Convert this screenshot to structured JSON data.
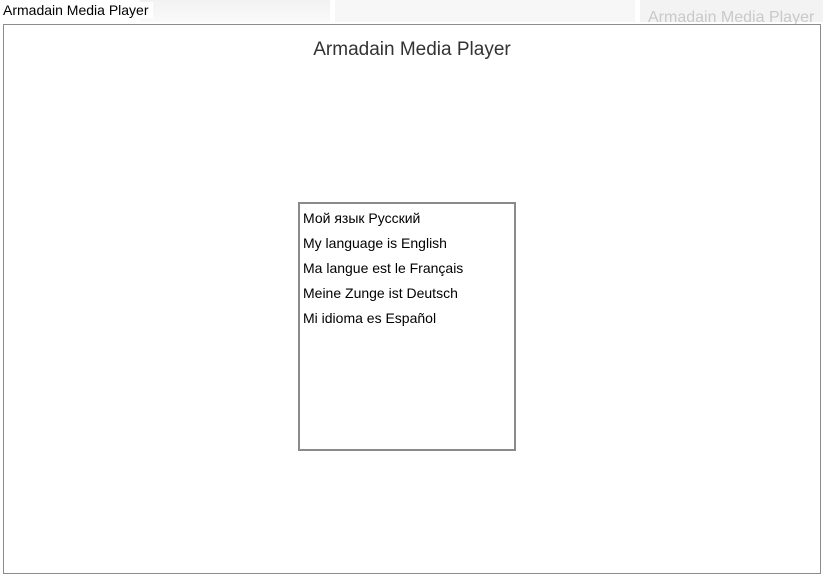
{
  "window": {
    "title": "Armadain Media Player",
    "background_title": "Armadain Media Player"
  },
  "main": {
    "heading": "Armadain Media Player",
    "language_list": {
      "items": [
        {
          "label": "Мой язык Русский"
        },
        {
          "label": "My language is English"
        },
        {
          "label": "Ma langue est le Français"
        },
        {
          "label": "Meine Zunge ist Deutsch"
        },
        {
          "label": "Mi idioma es Español"
        }
      ]
    }
  },
  "colors": {
    "window_border": "#8c8c8c",
    "listbox_border": "#8a8a8a",
    "heading_text": "#333333"
  }
}
